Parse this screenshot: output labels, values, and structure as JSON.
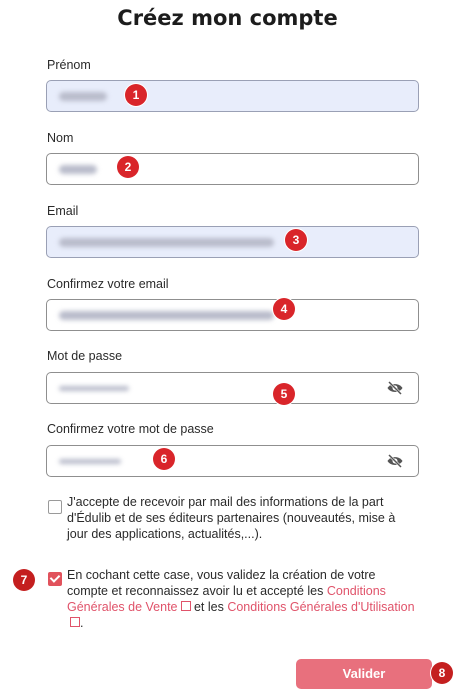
{
  "page": {
    "title": "Créez mon compte"
  },
  "form": {
    "first_name_label": "Prénom",
    "last_name_label": "Nom",
    "email_label": "Email",
    "confirm_email_label": "Confirmez votre email",
    "password_label": "Mot de passe",
    "confirm_password_label": "Confirmez votre mot de passe"
  },
  "newsletter": {
    "checked": false,
    "text": "J'accepte de recevoir par mail des informations de la part d'Édulib et de ses éditeurs partenaires (nouveautés, mise à jour des applications, actualités,...)."
  },
  "terms": {
    "checked": true,
    "text_before": "En cochant cette case, vous validez la création de votre compte et reconnaissez avoir lu et accepté les ",
    "cgv_link": "Conditions Générales de Vente",
    "text_between": " et les ",
    "cgu_link": "Conditions Générales d'Utilisation",
    "text_after": "."
  },
  "submit": {
    "label": "Valider"
  },
  "badges": [
    "1",
    "2",
    "3",
    "4",
    "5",
    "6",
    "7",
    "8"
  ],
  "colors": {
    "accent": "#e0536a",
    "badge": "#d9252a",
    "filled_field": "#e8edfb",
    "button": "#e8707d"
  },
  "icons": {
    "password_toggle": "eye-slash-icon",
    "external_link": "external-link-icon"
  }
}
